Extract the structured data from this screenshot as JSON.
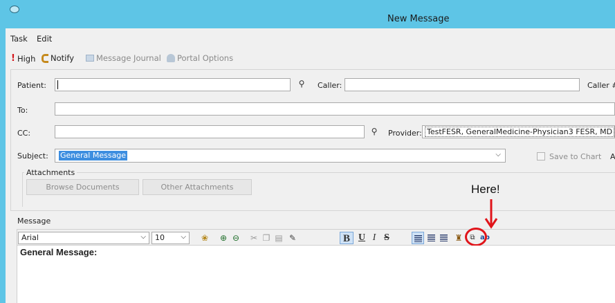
{
  "window": {
    "title": "New Message"
  },
  "menu": {
    "items": [
      "Task",
      "Edit"
    ]
  },
  "toolbar": {
    "high": "High",
    "notify": "Notify",
    "message_journal": "Message Journal",
    "portal_options": "Portal Options"
  },
  "form": {
    "patient_label": "Patient:",
    "patient_value": "",
    "caller_label": "Caller:",
    "caller_value": "",
    "caller_num_label": "Caller #",
    "to_label": "To:",
    "to_value": "",
    "cc_label": "CC:",
    "cc_value": "",
    "provider_label": "Provider:",
    "provider_value": "TestFESR, GeneralMedicine-Physician3 FESR, MD",
    "subject_label": "Subject:",
    "subject_value": "General Message",
    "save_to_chart_label": "Save to Chart",
    "save_to_chart_checked": false,
    "trailing_label": "A"
  },
  "attachments": {
    "legend": "Attachments",
    "browse_button": "Browse Documents",
    "other_button": "Other Attachments"
  },
  "annotation": {
    "text": "Here!",
    "color": "#e0141a"
  },
  "message": {
    "label": "Message",
    "font_name": "Arial",
    "font_size": "10",
    "body_text": "General Message:"
  },
  "format_icons": [
    "palette-icon",
    "zoom-in-icon",
    "zoom-out-icon",
    "cut-icon",
    "copy-icon",
    "paste-icon",
    "format-painter-icon",
    "bold-icon",
    "underline-icon",
    "italic-icon",
    "strikethrough-icon",
    "align-left-icon",
    "align-center-icon",
    "align-right-icon",
    "stamp-icon",
    "insert-field-icon",
    "spell-check-icon"
  ],
  "colors": {
    "titlebar": "#5ec5e6",
    "selection": "#3d8ee0",
    "high_priority": "#d4141a"
  }
}
